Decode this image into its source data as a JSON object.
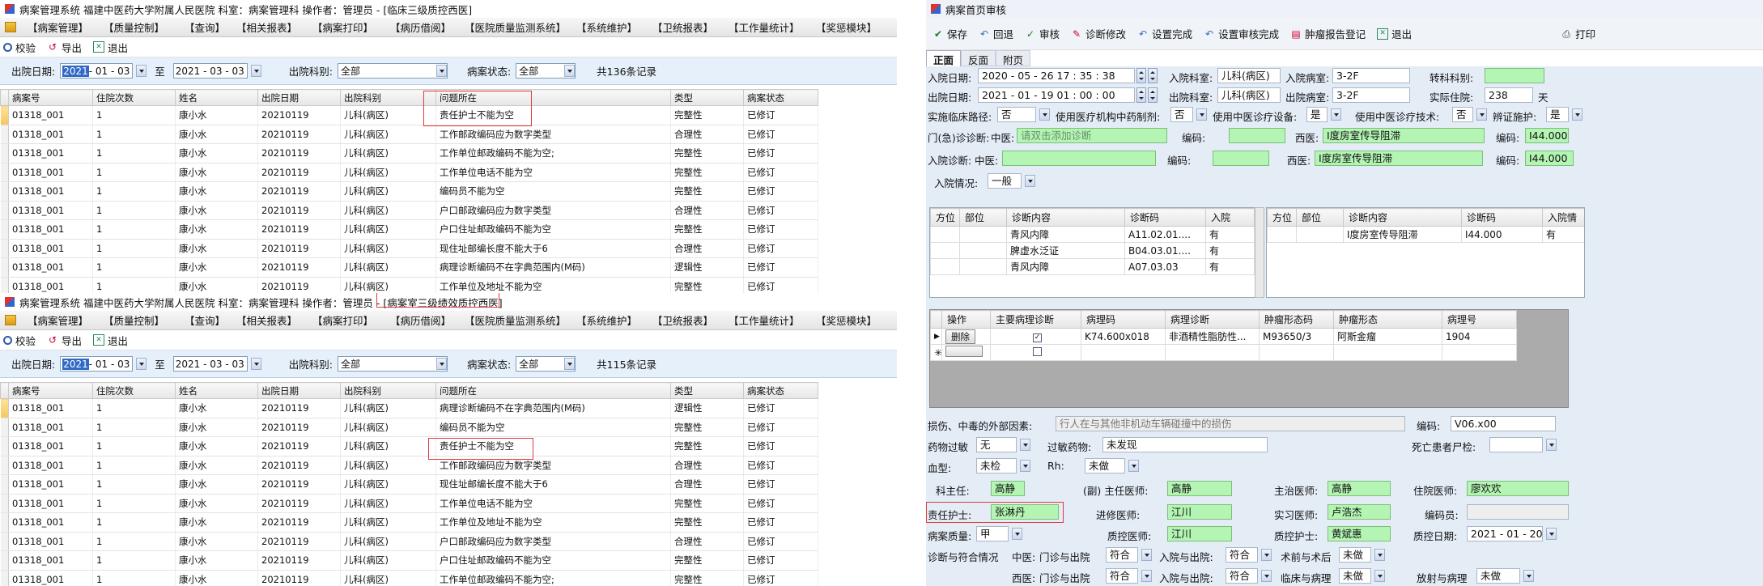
{
  "win_a": {
    "title": "病案管理系统  福建中医药大学附属人民医院  科室：病案管理科  操作者：管理员 - [临床三级质控西医]",
    "menu": [
      "【病案管理】",
      "【质量控制】",
      "【查询】",
      "【相关报表】",
      "【病案打印】",
      "【病历借阅】",
      "【医院质量监测系统】",
      "【系统维护】",
      "【卫统报表】",
      "【工作量统计】",
      "【奖惩模块】"
    ],
    "toolbar": {
      "verify": "校验",
      "export": "导出",
      "exit": "退出"
    },
    "filter": {
      "date_label": "出院日期:",
      "date_from_year": "2021",
      "date_from_rest": " - 01 - 03",
      "to": "至",
      "date_to": "2021 - 03 - 03",
      "dept_label": "出院科别:",
      "dept": "全部",
      "status_label": "病案状态:",
      "status": "全部",
      "count": "共136条记录"
    },
    "columns": [
      "病案号",
      "住院次数",
      "姓名",
      "出院日期",
      "出院科别",
      "问题所在",
      "类型",
      "病案状态"
    ],
    "rows": [
      [
        "01318_001",
        "1",
        "康小水",
        "20210119",
        "儿科(病区)",
        "责任护士不能为空",
        "完整性",
        "已修订"
      ],
      [
        "01318_001",
        "1",
        "康小水",
        "20210119",
        "儿科(病区)",
        "工作邮政编码应为数字类型",
        "合理性",
        "已修订"
      ],
      [
        "01318_001",
        "1",
        "康小水",
        "20210119",
        "儿科(病区)",
        "工作单位邮政编码不能为空;",
        "完整性",
        "已修订"
      ],
      [
        "01318_001",
        "1",
        "康小水",
        "20210119",
        "儿科(病区)",
        "工作单位电话不能为空",
        "完整性",
        "已修订"
      ],
      [
        "01318_001",
        "1",
        "康小水",
        "20210119",
        "儿科(病区)",
        "编码员不能为空",
        "完整性",
        "已修订"
      ],
      [
        "01318_001",
        "1",
        "康小水",
        "20210119",
        "儿科(病区)",
        "户口邮政编码应为数字类型",
        "合理性",
        "已修订"
      ],
      [
        "01318_001",
        "1",
        "康小水",
        "20210119",
        "儿科(病区)",
        "户口住址邮政编码不能为空",
        "完整性",
        "已修订"
      ],
      [
        "01318_001",
        "1",
        "康小水",
        "20210119",
        "儿科(病区)",
        "现住址邮编长度不能大于6",
        "合理性",
        "已修订"
      ],
      [
        "01318_001",
        "1",
        "康小水",
        "20210119",
        "儿科(病区)",
        "病理诊断编码不在字典范围内(M码)",
        "逻辑性",
        "已修订"
      ],
      [
        "01318_001",
        "1",
        "康小水",
        "20210119",
        "儿科(病区)",
        "工作单位及地址不能为空",
        "完整性",
        "已修订"
      ]
    ]
  },
  "win_b": {
    "title": "病案管理系统  福建中医药大学附属人民医院  科室：病案管理科  操作者：管理员 - [病案室三级绩效质控西医]",
    "menu": [
      "【病案管理】",
      "【质量控制】",
      "【查询】",
      "【相关报表】",
      "【病案打印】",
      "【病历借阅】",
      "【医院质量监测系统】",
      "【系统维护】",
      "【卫统报表】",
      "【工作量统计】",
      "【奖惩模块】"
    ],
    "toolbar": {
      "verify": "校验",
      "export": "导出",
      "exit": "退出"
    },
    "filter": {
      "date_label": "出院日期:",
      "date_from_year": "2021",
      "date_from_rest": " - 01 - 03",
      "to": "至",
      "date_to": "2021 - 03 - 03",
      "dept_label": "出院科别:",
      "dept": "全部",
      "status_label": "病案状态:",
      "status": "全部",
      "count": "共115条记录"
    },
    "columns": [
      "病案号",
      "住院次数",
      "姓名",
      "出院日期",
      "出院科别",
      "问题所在",
      "类型",
      "病案状态"
    ],
    "rows": [
      [
        "01318_001",
        "1",
        "康小水",
        "20210119",
        "儿科(病区)",
        "病理诊断编码不在字典范围内(M码)",
        "逻辑性",
        "已修订"
      ],
      [
        "01318_001",
        "1",
        "康小水",
        "20210119",
        "儿科(病区)",
        "编码员不能为空",
        "完整性",
        "已修订"
      ],
      [
        "01318_001",
        "1",
        "康小水",
        "20210119",
        "儿科(病区)",
        "责任护士不能为空",
        "完整性",
        "已修订"
      ],
      [
        "01318_001",
        "1",
        "康小水",
        "20210119",
        "儿科(病区)",
        "工作邮政编码应为数字类型",
        "合理性",
        "已修订"
      ],
      [
        "01318_001",
        "1",
        "康小水",
        "20210119",
        "儿科(病区)",
        "现住址邮编长度不能大于6",
        "合理性",
        "已修订"
      ],
      [
        "01318_001",
        "1",
        "康小水",
        "20210119",
        "儿科(病区)",
        "工作单位电话不能为空",
        "完整性",
        "已修订"
      ],
      [
        "01318_001",
        "1",
        "康小水",
        "20210119",
        "儿科(病区)",
        "工作单位及地址不能为空",
        "完整性",
        "已修订"
      ],
      [
        "01318_001",
        "1",
        "康小水",
        "20210119",
        "儿科(病区)",
        "户口邮政编码应为数字类型",
        "合理性",
        "已修订"
      ],
      [
        "01318_001",
        "1",
        "康小水",
        "20210119",
        "儿科(病区)",
        "户口住址邮政编码不能为空",
        "完整性",
        "已修订"
      ],
      [
        "01318_001",
        "1",
        "康小水",
        "20210119",
        "儿科(病区)",
        "工作单位邮政编码不能为空;",
        "完整性",
        "已修订"
      ]
    ]
  },
  "win_c": {
    "title": "病案首页审核",
    "toolbar": {
      "save": "保存",
      "back": "回退",
      "audit": "审核",
      "diag_modify": "诊断修改",
      "set_done": "设置完成",
      "set_audit_done": "设置审核完成",
      "tumor": "肿瘤报告登记",
      "exit": "退出",
      "print": "打印"
    },
    "tabs": [
      "正面",
      "反面",
      "附页"
    ],
    "admit_date_label": "入院日期:",
    "admit_date": "2020 - 05 - 26   17 : 35 : 38",
    "admit_dept_label": "入院科室:",
    "admit_dept": "儿科(病区)",
    "admit_ward_label": "入院病室:",
    "admit_ward": "3-2F",
    "transfer_label": "转科科别:",
    "disc_date_label": "出院日期:",
    "disc_date": "2021 - 01 - 19   01 : 00 : 00",
    "disc_dept_label": "出院科室:",
    "disc_dept": "儿科(病区)",
    "disc_ward_label": "出院病室:",
    "disc_ward": "3-2F",
    "days_label": "实际住院:",
    "days": "238",
    "days_unit": "天",
    "path_label": "实施临床路径:",
    "path_val": "否",
    "opt1_label": "使用医疗机构中药制剂:",
    "opt1_val": "否",
    "opt2_label": "使用中医诊疗设备:",
    "opt2_val": "是",
    "opt3_label": "使用中医诊疗技术:",
    "opt3_val": "否",
    "opt4_label": "辨证施护:",
    "opt4_val": "是",
    "op_diag_label": "门(急)诊诊断:",
    "op_tcm_label": "中医:",
    "op_tcm_placeholder": "请双击添加诊断",
    "code_label": "编码:",
    "west_label": "西医:",
    "op_west": "Ⅰ度房室传导阻滞",
    "op_west_code": "I44.000",
    "in_diag_label": "入院诊断:",
    "in_tcm_label": "中医:",
    "in_west": "Ⅰ度房室传导阻滞",
    "in_west_code": "I44.000",
    "in_cond_label": "入院情况:",
    "in_cond": "一般",
    "diag_cols_left": [
      "方位",
      "部位",
      "诊断内容",
      "诊断码",
      "入院"
    ],
    "diag_rows_left": [
      [
        "",
        "",
        "青风内障",
        "A11.02.01....",
        "有"
      ],
      [
        "",
        "",
        "脾虚水泛证",
        "B04.03.01....",
        "有"
      ],
      [
        "",
        "",
        "青风内障",
        "A07.03.03",
        "有"
      ]
    ],
    "diag_cols_right": [
      "方位",
      "部位",
      "诊断内容",
      "诊断码",
      "入院情"
    ],
    "diag_rows_right": [
      [
        "",
        "",
        "Ⅰ度房室传导阻滞",
        "I44.000",
        "有"
      ]
    ],
    "path_cols": [
      "操作",
      "主要病理诊断",
      "病理码",
      "病理诊断",
      "肿瘤形态码",
      "肿瘤形态",
      "病理号"
    ],
    "path_row": {
      "op": "删除",
      "code": "K74.600x018",
      "diag": "非酒精性脂肪性...",
      "morph_code": "M93650/3",
      "morph": "阿斯金瘤",
      "no": "1904"
    },
    "ext_label": "损伤、中毒的外部因素:",
    "ext_value": "行人在与其他非机动车辆碰撞中的损伤",
    "ext_code_label": "编码:",
    "ext_code": "V06.x00",
    "allergy_label": "药物过敏",
    "allergy": "无",
    "allergy_drug_label": "过敏药物:",
    "allergy_drug": "未发现",
    "death_label": "死亡患者尸检:",
    "blood_label": "血型:",
    "blood": "未检",
    "rh_label": "Rh:",
    "rh": "未做",
    "dir_label": "科主任:",
    "dir": "高静",
    "chief_label": "(副) 主任医师:",
    "chief": "高静",
    "attend_label": "主治医师:",
    "attend": "高静",
    "resident_label": "住院医师:",
    "resident": "廖欢欢",
    "nurse_label": "责任护士:",
    "nurse": "张淋丹",
    "refresher_label": "进修医师:",
    "refresher": "江川",
    "intern_label": "实习医师:",
    "intern": "卢浩杰",
    "coder_label": "编码员:",
    "quality_label": "病案质量:",
    "quality": "甲",
    "qc_doc_label": "质控医师:",
    "qc_doc": "江川",
    "qc_nurse_label": "质控护士:",
    "qc_nurse": "黄斌惠",
    "qc_date_label": "质控日期:",
    "qc_date": "2021 - 01 - 20",
    "diag_match_label": "诊断与符合情况",
    "west_match_label": "中医:",
    "tcm_op_label": "门诊与出院",
    "tcm_op": "符合",
    "tcm_inout_label": "入院与出院:",
    "tcm_inout": "符合",
    "pre_post_label": "术前与术后",
    "pre_post": "未做",
    "west2_label": "西医:",
    "west_op_label": "门诊与出院",
    "west_op": "符合",
    "west_inout_label": "入院与出院:",
    "west_inout": "符合",
    "clin_path_label": "临床与病理",
    "clin_path": "未做",
    "rad_path_label": "放射与病理",
    "rad_path": "未做"
  }
}
